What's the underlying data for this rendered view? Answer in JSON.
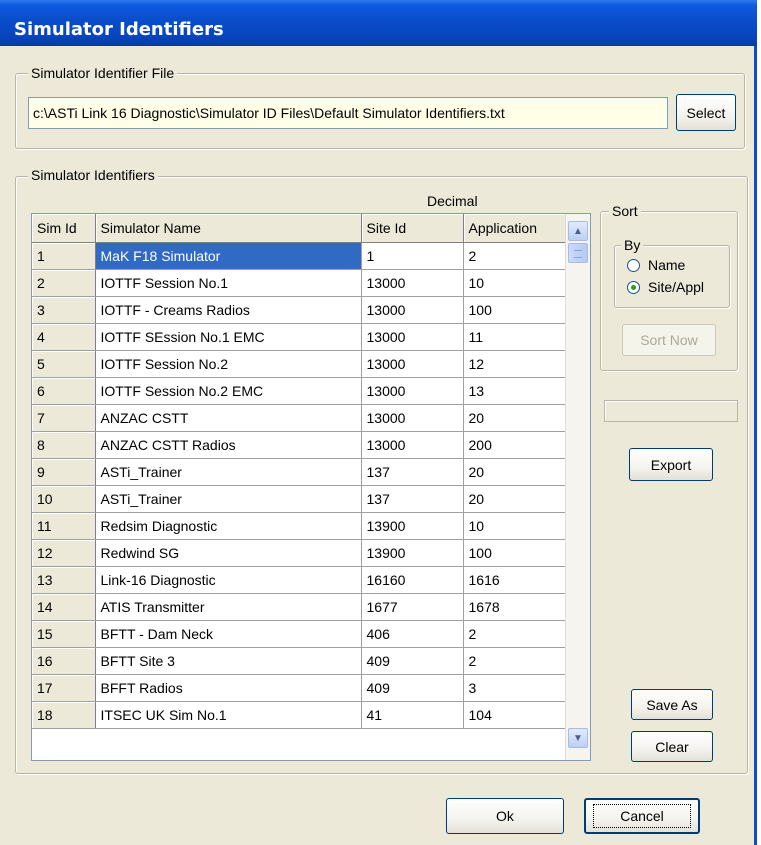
{
  "window": {
    "title": "Simulator Identifiers"
  },
  "file_group": {
    "legend": "Simulator Identifier File",
    "path": "c:\\ASTi Link 16 Diagnostic\\Simulator ID Files\\Default Simulator Identifiers.txt",
    "select_label": "Select"
  },
  "ids_group": {
    "legend": "Simulator Identifiers",
    "decimal_label": "Decimal"
  },
  "table": {
    "columns": [
      "Sim Id",
      "Simulator Name",
      "Site Id",
      "Application"
    ],
    "rows": [
      [
        "1",
        "MaK F18 Simulator",
        "1",
        "2"
      ],
      [
        "2",
        "IOTTF Session No.1",
        "13000",
        "10"
      ],
      [
        "3",
        "IOTTF - Creams Radios",
        "13000",
        "100"
      ],
      [
        "4",
        "IOTTF SEssion No.1 EMC",
        "13000",
        "11"
      ],
      [
        "5",
        "IOTTF Session No.2",
        "13000",
        "12"
      ],
      [
        "6",
        "IOTTF Session No.2 EMC",
        "13000",
        "13"
      ],
      [
        "7",
        "ANZAC CSTT",
        "13000",
        "20"
      ],
      [
        "8",
        "ANZAC CSTT Radios",
        "13000",
        "200"
      ],
      [
        "9",
        "ASTi_Trainer",
        "137",
        "20"
      ],
      [
        "10",
        "ASTi_Trainer",
        "137",
        "20"
      ],
      [
        "11",
        "Redsim Diagnostic",
        "13900",
        "10"
      ],
      [
        "12",
        "Redwind SG",
        "13900",
        "100"
      ],
      [
        "13",
        "Link-16 Diagnostic",
        "16160",
        "1616"
      ],
      [
        "14",
        "ATIS Transmitter",
        "1677",
        "1678"
      ],
      [
        "15",
        "BFTT - Dam Neck",
        "406",
        "2"
      ],
      [
        "16",
        "BFTT Site 3",
        "409",
        "2"
      ],
      [
        "17",
        "BFFT Radios",
        "409",
        "3"
      ],
      [
        "18",
        "ITSEC UK Sim No.1",
        "41",
        "104"
      ]
    ]
  },
  "sort": {
    "legend": "Sort",
    "by_legend": "By",
    "options": [
      {
        "label": "Name",
        "checked": false
      },
      {
        "label": "Site/Appl",
        "checked": true
      }
    ],
    "sort_now_label": "Sort Now"
  },
  "buttons": {
    "export": "Export",
    "save_as": "Save As",
    "clear": "Clear",
    "ok": "Ok",
    "cancel": "Cancel"
  },
  "colors": {
    "title_bar": "#0a4ecb",
    "selection": "#316ac5",
    "file_field_bg": "#ffffe8",
    "dialog_bg": "#ece9d8"
  }
}
